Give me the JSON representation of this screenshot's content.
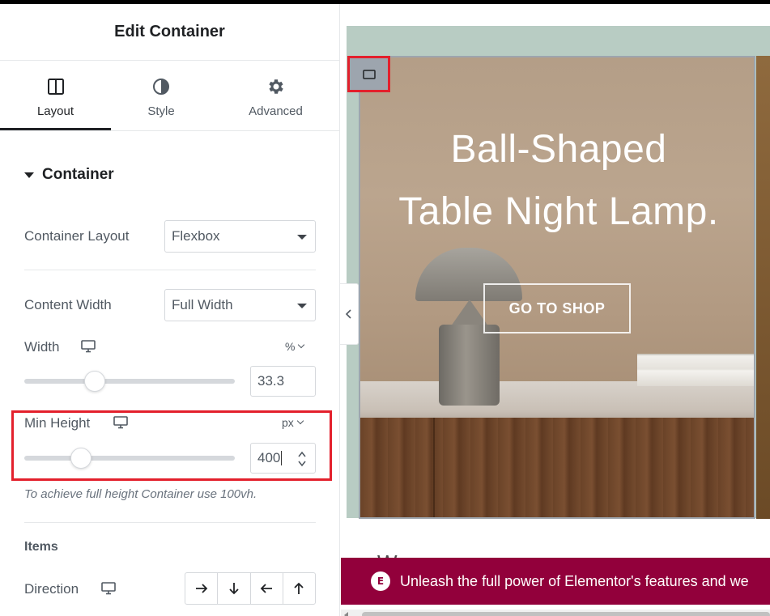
{
  "panel": {
    "title": "Edit Container",
    "tabs": [
      {
        "label": "Layout",
        "icon": "layout-columns-icon",
        "active": true
      },
      {
        "label": "Style",
        "icon": "half-circle-contrast-icon",
        "active": false
      },
      {
        "label": "Advanced",
        "icon": "gear-icon",
        "active": false
      }
    ],
    "section": {
      "title": "Container",
      "expanded": true
    },
    "container_layout": {
      "label": "Container Layout",
      "value": "Flexbox"
    },
    "content_width": {
      "label": "Content Width",
      "value": "Full Width"
    },
    "width": {
      "label": "Width",
      "device_icon": "desktop-icon",
      "unit": "%",
      "value": "33.3",
      "slider_fraction": 0.333
    },
    "min_height": {
      "label": "Min Height",
      "device_icon": "desktop-icon",
      "unit": "px",
      "value": "400",
      "slider_fraction": 0.27
    },
    "hint": "To achieve full height Container use 100vh.",
    "items_title": "Items",
    "direction": {
      "label": "Direction",
      "device_icon": "desktop-icon",
      "options": [
        "arrow-right-icon",
        "arrow-down-icon",
        "arrow-left-icon",
        "arrow-up-icon"
      ]
    }
  },
  "preview": {
    "hero_line1": "Ball-Shaped",
    "hero_line2": "Table Night Lamp.",
    "cta": "GO TO SHOP",
    "below_text": "We ... ...",
    "promo": "Unleash the full power of Elementor's features and we",
    "promo_icon": "elementor-logo-icon"
  },
  "colors": {
    "highlight": "#e3202c",
    "promo_bg": "#92003b",
    "band_bg": "#b8ccc3",
    "handle_bg": "#9da5ae"
  }
}
